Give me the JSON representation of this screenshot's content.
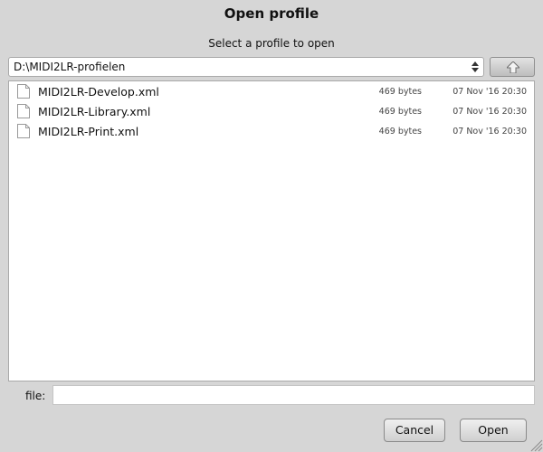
{
  "dialog": {
    "title": "Open profile",
    "instructions": "Select a profile to open"
  },
  "path_selector": {
    "value": "D:\\MIDI2LR-profielen",
    "arrows_icon": "up-down-arrows-icon",
    "up_button_icon": "arrow-up-icon"
  },
  "files": [
    {
      "name": "MIDI2LR-Develop.xml",
      "size": "469 bytes",
      "date": "07 Nov '16 20:30",
      "icon": "document-icon"
    },
    {
      "name": "MIDI2LR-Library.xml",
      "size": "469 bytes",
      "date": "07 Nov '16 20:30",
      "icon": "document-icon"
    },
    {
      "name": "MIDI2LR-Print.xml",
      "size": "469 bytes",
      "date": "07 Nov '16 20:30",
      "icon": "document-icon"
    }
  ],
  "filename_field": {
    "label": "file:",
    "value": ""
  },
  "buttons": {
    "cancel": "Cancel",
    "open": "Open"
  },
  "colors": {
    "background": "#d6d6d6",
    "list_background": "#ffffff"
  }
}
